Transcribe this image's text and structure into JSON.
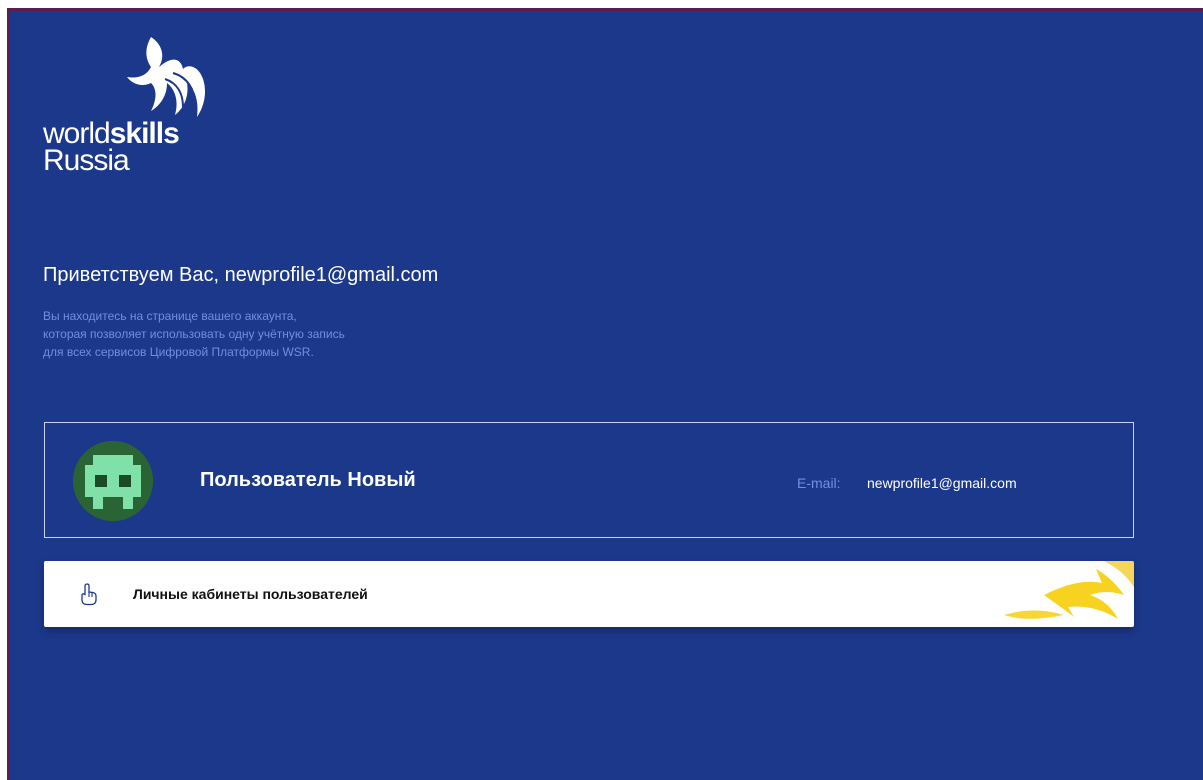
{
  "logo": {
    "word1": "world",
    "word2": "skills",
    "word3": "Russia"
  },
  "welcome": {
    "greeting": "Приветствуем Вас, newprofile1@gmail.com",
    "lines": [
      "Вы находитесь на странице вашего аккаунта,",
      "которая позволяет использовать одну учётную запись",
      "для всех сервисов Цифровой Платформы WSR."
    ]
  },
  "profile": {
    "name": "Пользователь Новый",
    "email_label": "E-mail:",
    "email": "newprofile1@gmail.com"
  },
  "cabinet": {
    "label": "Личные кабинеты пользователей",
    "icon": "hand-pointer-icon"
  },
  "colors": {
    "background": "#1c388a",
    "accent_text": "#6f8fe4",
    "avatar_bg": "#2a6434",
    "avatar_pixel": "#7fe0a8",
    "deco_yellow": "#f7d21e"
  }
}
